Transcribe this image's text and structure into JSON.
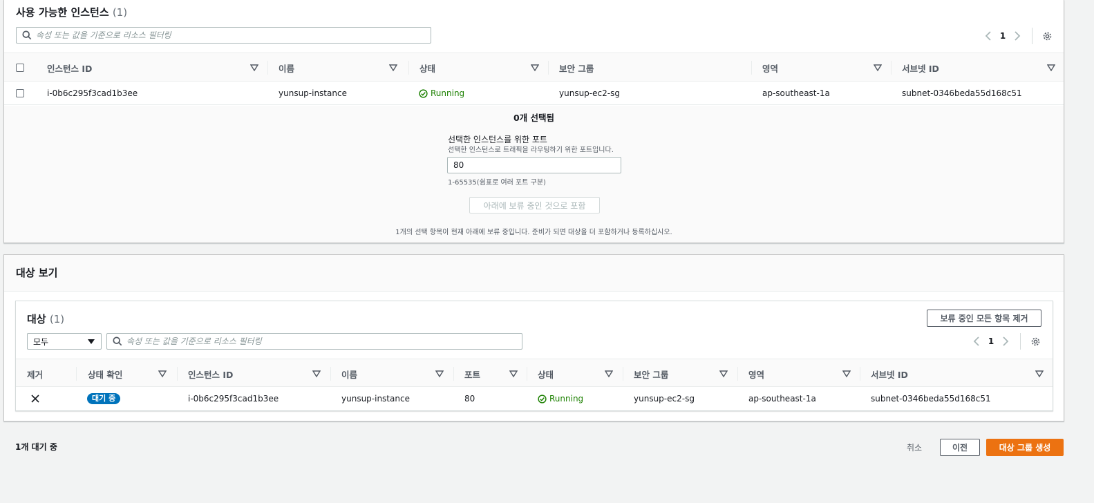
{
  "available": {
    "title": "사용 가능한 인스턴스",
    "count": "(1)",
    "search_placeholder": "속성 또는 값을 기준으로 리소스 필터링",
    "page": "1",
    "columns": [
      "인스턴스 ID",
      "이름",
      "상태",
      "보안 그룹",
      "영역",
      "서브넷 ID"
    ],
    "rows": [
      {
        "instance_id": "i-0b6c295f3cad1b3ee",
        "name": "yunsup-instance",
        "status": "Running",
        "security_group": "yunsup-ec2-sg",
        "zone": "ap-southeast-1a",
        "subnet_id": "subnet-0346beda55d168c51"
      }
    ],
    "selected_count": "0개 선택됨",
    "port_label": "선택한 인스턴스를 위한 포트",
    "port_description": "선택한 인스턴스로 트래픽을 라우팅하기 위한 포트입니다.",
    "port_value": "80",
    "port_hint": "1-65535(쉼표로 여러 포트 구분)",
    "include_button": "아래에 보류 중인 것으로 포함",
    "pending_notice": "1개의 선택 항목이 현재 아래에 보류 중입니다. 준비가 되면 대상을 더 포함하거나 등록하십시오."
  },
  "view": {
    "title": "대상 보기",
    "targets_title": "대상",
    "targets_count": "(1)",
    "remove_all_button": "보류 중인 모든 항목 제거",
    "filter_select": "모두",
    "search_placeholder": "속성 또는 값을 기준으로 리소스 필터링",
    "page": "1",
    "columns": [
      "제거",
      "상태 확인",
      "인스턴스 ID",
      "이름",
      "포트",
      "상태",
      "보안 그룹",
      "영역",
      "서브넷 ID"
    ],
    "rows": [
      {
        "health": "대기 중",
        "instance_id": "i-0b6c295f3cad1b3ee",
        "name": "yunsup-instance",
        "port": "80",
        "status": "Running",
        "security_group": "yunsup-ec2-sg",
        "zone": "ap-southeast-1a",
        "subnet_id": "subnet-0346beda55d168c51"
      }
    ]
  },
  "footer": {
    "pending": "1개 대기 중",
    "cancel": "취소",
    "previous": "이전",
    "create": "대상 그룹 생성"
  },
  "colors": {
    "primary": "#ec7211",
    "running": "#1d8102",
    "badge": "#0073bb"
  }
}
